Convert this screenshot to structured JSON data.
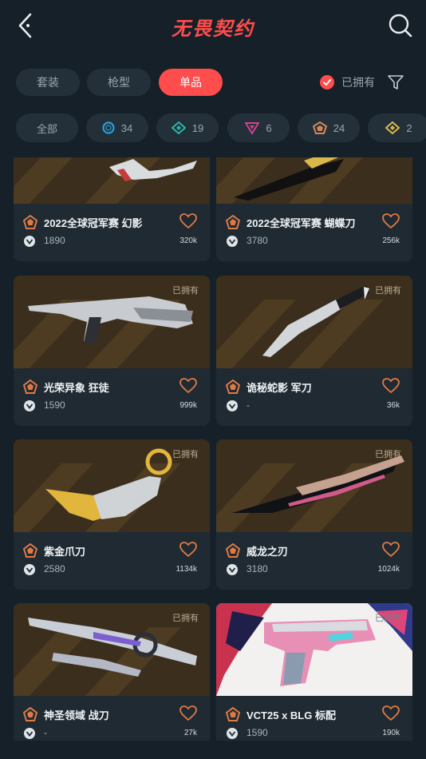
{
  "header": {
    "title": "无畏契约",
    "back_icon": "chevron-left-icon",
    "search_icon": "search-icon"
  },
  "tabs": [
    {
      "label": "套装",
      "active": false
    },
    {
      "label": "枪型",
      "active": false
    },
    {
      "label": "单品",
      "active": true
    }
  ],
  "owned_filter": {
    "label": "已拥有",
    "checked": true
  },
  "filter_icon": "funnel-icon",
  "tiers": [
    {
      "label": "全部",
      "count": ""
    },
    {
      "label": "",
      "count": "34",
      "color": "#2a9fd6",
      "shape": "circle"
    },
    {
      "label": "",
      "count": "19",
      "color": "#2bb3a3",
      "shape": "diamond"
    },
    {
      "label": "",
      "count": "6",
      "color": "#d0418c",
      "shape": "triangle"
    },
    {
      "label": "",
      "count": "24",
      "color": "#d6875a",
      "shape": "pentagon"
    },
    {
      "label": "",
      "count": "2",
      "color": "#d8b84a",
      "shape": "diamond"
    }
  ],
  "items": [
    {
      "name": "2022全球冠军赛 幻影",
      "price": "1890",
      "likes": "320k",
      "owned": ""
    },
    {
      "name": "2022全球冠军赛 蝴蝶刀",
      "price": "3780",
      "likes": "256k",
      "owned": ""
    },
    {
      "name": "光荣异象 狂徒",
      "price": "1590",
      "likes": "999k",
      "owned": "已拥有"
    },
    {
      "name": "诡秘蛇影 军刀",
      "price": "-",
      "likes": "36k",
      "owned": "已拥有"
    },
    {
      "name": "紫金爪刀",
      "price": "2580",
      "likes": "1134k",
      "owned": "已拥有"
    },
    {
      "name": "威龙之刃",
      "price": "3180",
      "likes": "1024k",
      "owned": "已拥有"
    },
    {
      "name": "神圣领域 战刀",
      "price": "-",
      "likes": "27k",
      "owned": "已拥有"
    },
    {
      "name": "VCT25 x BLG 标配",
      "price": "1590",
      "likes": "190k",
      "owned": "已拥有"
    }
  ],
  "colors": {
    "accent": "#ff4c4c",
    "tier_icon": "#e07a45",
    "background": "#162028",
    "card": "#1f2a33"
  }
}
